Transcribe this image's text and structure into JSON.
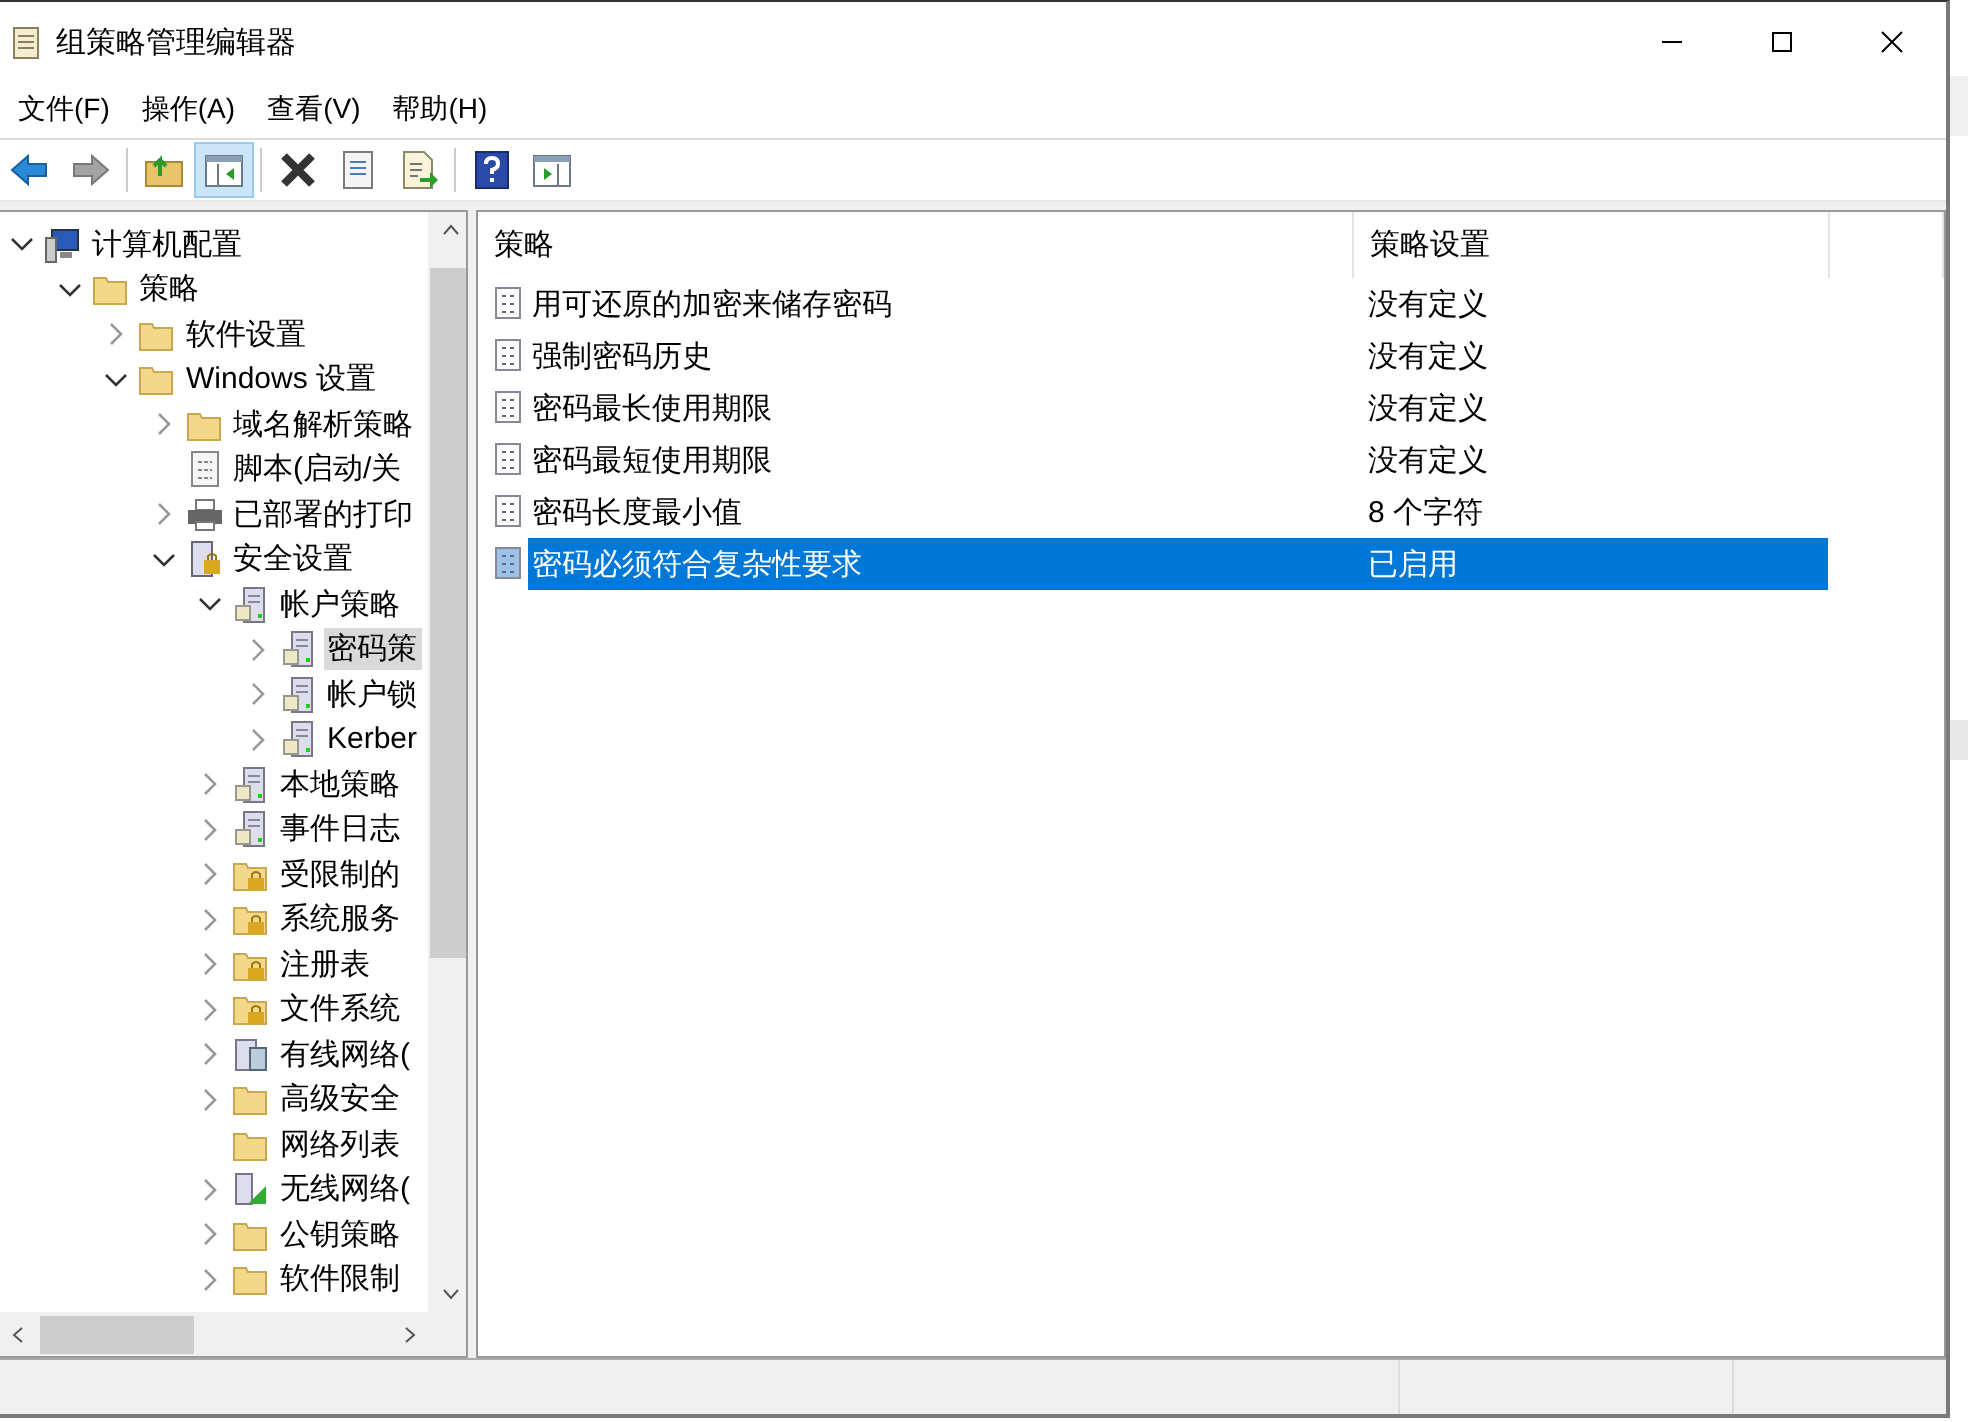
{
  "window": {
    "title": "组策略管理编辑器"
  },
  "menu": [
    "文件(F)",
    "操作(A)",
    "查看(V)",
    "帮助(H)"
  ],
  "toolbar": [
    {
      "kind": "back",
      "disabled": false,
      "pressed": false
    },
    {
      "kind": "forward",
      "disabled": true,
      "pressed": false
    },
    {
      "kind": "sep"
    },
    {
      "kind": "up",
      "disabled": false,
      "pressed": false
    },
    {
      "kind": "tree",
      "disabled": false,
      "pressed": true
    },
    {
      "kind": "sep"
    },
    {
      "kind": "delete",
      "disabled": false,
      "pressed": false
    },
    {
      "kind": "properties",
      "disabled": false,
      "pressed": false
    },
    {
      "kind": "export",
      "disabled": false,
      "pressed": false
    },
    {
      "kind": "sep"
    },
    {
      "kind": "help",
      "disabled": false,
      "pressed": false
    },
    {
      "kind": "pane",
      "disabled": false,
      "pressed": false
    }
  ],
  "tree": [
    {
      "label": "计算机配置",
      "kind": "computer",
      "expanded": true,
      "selected": false,
      "children": [
        {
          "label": "策略",
          "kind": "folder",
          "expanded": true,
          "selected": false,
          "children": [
            {
              "label": "软件设置",
              "kind": "folder",
              "expanded": false,
              "selected": false
            },
            {
              "label": "Windows 设置",
              "kind": "folder",
              "expanded": true,
              "selected": false,
              "children": [
                {
                  "label": "域名解析策略",
                  "kind": "folder",
                  "expanded": false,
                  "selected": false
                },
                {
                  "label": "脚本(启动/关",
                  "kind": "script",
                  "leaf": true,
                  "expanded": false,
                  "selected": false
                },
                {
                  "label": "已部署的打印",
                  "kind": "printer",
                  "expanded": false,
                  "selected": false
                },
                {
                  "label": "安全设置",
                  "kind": "security",
                  "expanded": true,
                  "selected": false,
                  "children": [
                    {
                      "label": "帐户策略",
                      "kind": "server",
                      "expanded": true,
                      "selected": false,
                      "children": [
                        {
                          "label": "密码策",
                          "kind": "server",
                          "expanded": false,
                          "selected": true
                        },
                        {
                          "label": "帐户锁",
                          "kind": "server",
                          "expanded": false,
                          "selected": false
                        },
                        {
                          "label": "Kerber",
                          "kind": "server",
                          "expanded": false,
                          "selected": false
                        }
                      ]
                    },
                    {
                      "label": "本地策略",
                      "kind": "server",
                      "expanded": false,
                      "selected": false
                    },
                    {
                      "label": "事件日志",
                      "kind": "server",
                      "expanded": false,
                      "selected": false
                    },
                    {
                      "label": "受限制的",
                      "kind": "lockfolder",
                      "expanded": false,
                      "selected": false
                    },
                    {
                      "label": "系统服务",
                      "kind": "lockfolder",
                      "expanded": false,
                      "selected": false
                    },
                    {
                      "label": "注册表",
                      "kind": "lockfolder",
                      "expanded": false,
                      "selected": false
                    },
                    {
                      "label": "文件系统",
                      "kind": "lockfolder",
                      "expanded": false,
                      "selected": false
                    },
                    {
                      "label": "有线网络(",
                      "kind": "network",
                      "expanded": false,
                      "selected": false
                    },
                    {
                      "label": "高级安全",
                      "kind": "folder",
                      "expanded": false,
                      "selected": false
                    },
                    {
                      "label": "网络列表",
                      "kind": "folder",
                      "leaf": true,
                      "expanded": false,
                      "selected": false
                    },
                    {
                      "label": "无线网络(",
                      "kind": "wireless",
                      "expanded": false,
                      "selected": false
                    },
                    {
                      "label": "公钥策略",
                      "kind": "folder",
                      "expanded": false,
                      "selected": false
                    },
                    {
                      "label": "软件限制",
                      "kind": "folder",
                      "expanded": false,
                      "selected": false
                    }
                  ]
                }
              ]
            }
          ]
        }
      ]
    }
  ],
  "list": {
    "columns": [
      "策略",
      "策略设置"
    ],
    "rows": [
      {
        "policy": "用可还原的加密来储存密码",
        "setting": "没有定义",
        "selected": false
      },
      {
        "policy": "强制密码历史",
        "setting": "没有定义",
        "selected": false
      },
      {
        "policy": "密码最长使用期限",
        "setting": "没有定义",
        "selected": false
      },
      {
        "policy": "密码最短使用期限",
        "setting": "没有定义",
        "selected": false
      },
      {
        "policy": "密码长度最小值",
        "setting": "8 个字符",
        "selected": false
      },
      {
        "policy": "密码必须符合复杂性要求",
        "setting": "已启用",
        "selected": true
      }
    ]
  }
}
